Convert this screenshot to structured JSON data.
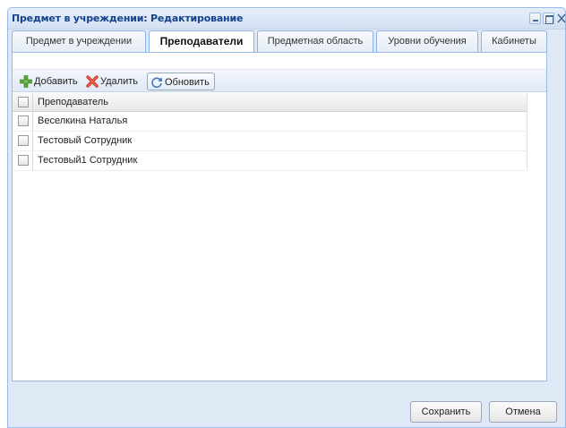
{
  "window": {
    "title": "Предмет в учреждении: Редактирование"
  },
  "tabs": [
    {
      "label": "Предмет в учреждении",
      "active": false
    },
    {
      "label": "Преподаватели",
      "active": true
    },
    {
      "label": "Предметная область",
      "active": false
    },
    {
      "label": "Уровни обучения",
      "active": false
    },
    {
      "label": "Кабинеты",
      "active": false
    }
  ],
  "toolbar": {
    "add_label": "Добавить",
    "delete_label": "Удалить",
    "refresh_label": "Обновить"
  },
  "grid": {
    "column_header": "Преподаватель",
    "rows": [
      "Веселкина Наталья",
      "Тестовый Сотрудник",
      "Тестовый1 Сотрудник"
    ]
  },
  "footer": {
    "save_label": "Сохранить",
    "cancel_label": "Отмена"
  },
  "colors": {
    "window_border": "#99bbe8",
    "title_text": "#15428b",
    "add_icon": "#5aa43a",
    "delete_icon": "#d43a2a"
  },
  "icons": {
    "add": "plus-icon",
    "delete": "cross-icon",
    "refresh": "refresh-icon"
  }
}
